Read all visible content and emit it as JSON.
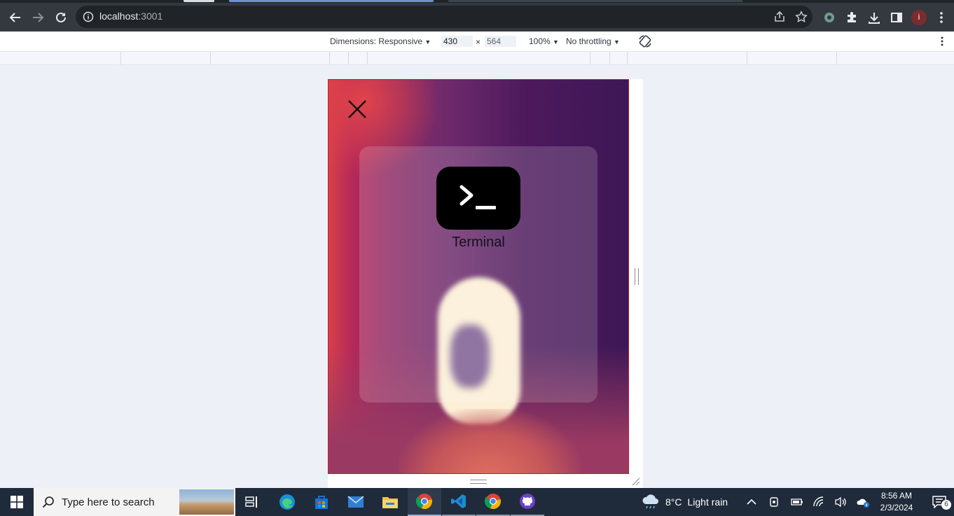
{
  "browser": {
    "url_host": "localhost",
    "url_port": ":3001",
    "profile_initial": "i",
    "colors": {
      "chrome_bg": "#34393f",
      "omnibox_bg": "#202428",
      "accent_tab": "#6f8fcf"
    }
  },
  "devtools": {
    "dimensions_label": "Dimensions: Responsive",
    "width_value": "430",
    "times": "×",
    "height_value": "564",
    "zoom": "100%",
    "throttling": "No throttling"
  },
  "app": {
    "close_icon": "close-icon",
    "tile_label": "Terminal",
    "tile_icon": "terminal-prompt-icon",
    "colors": {
      "viewport_border": "#c31d2e",
      "tile_bg": "#000000"
    }
  },
  "taskbar": {
    "search_placeholder": "Type here to search",
    "weather_temp": "8°C",
    "weather_desc": "Light rain",
    "time": "8:56 AM",
    "date": "2/3/2024",
    "notification_count": "6",
    "pinned": [
      "task-view-icon",
      "edge-icon",
      "store-icon",
      "mail-icon",
      "file-explorer-icon",
      "chrome-icon",
      "vscode-icon",
      "chrome-icon",
      "github-desktop-icon"
    ]
  }
}
